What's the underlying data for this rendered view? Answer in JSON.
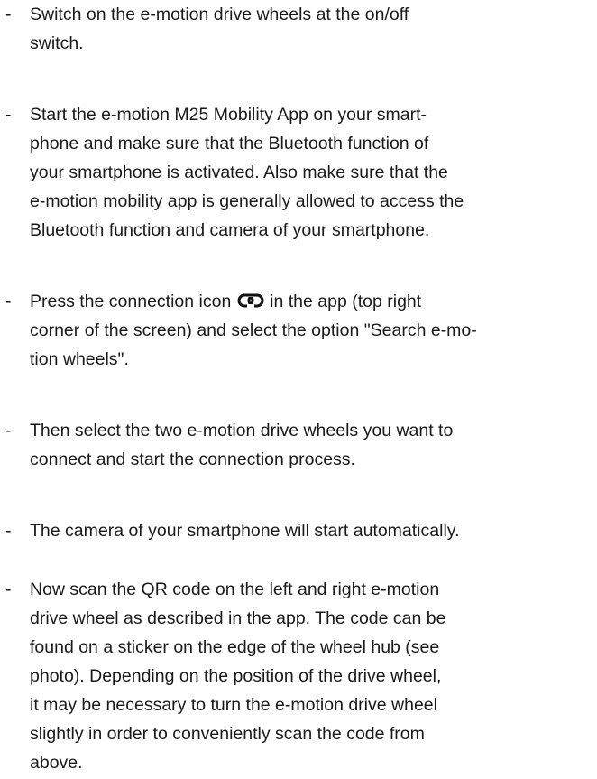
{
  "bullet": "-",
  "items": [
    {
      "lines": [
        "Switch on the e-motion drive wheels at the on/off",
        "switch."
      ]
    },
    {
      "lines": [
        "Start the e-motion M25 Mobility App on your smart-",
        "phone and make sure that the Bluetooth function of",
        "your smartphone is activated. Also make sure that the",
        "e-motion mobility app is generally allowed to access the",
        "Bluetooth function and camera of your smartphone."
      ]
    },
    {
      "line1_before_icon": "Press the connection icon",
      "icon": "link-icon",
      "line1_after_icon": "in the app (top right",
      "lines": [
        "corner of the screen) and select the option \"Search e-mo-",
        "tion wheels\"."
      ]
    },
    {
      "lines": [
        "Then select the two e-motion drive wheels you want to",
        "connect and start the connection process."
      ]
    },
    {
      "lines": [
        "The camera of your smartphone will start automatically."
      ]
    },
    {
      "lines": [
        "Now scan the QR code on the left and right e-motion",
        "drive wheel as described in the app. The code can be",
        "found on a sticker on the edge of the wheel hub (see",
        "photo). Depending on the position of the drive wheel,",
        "it may be necessary to turn the e-motion drive wheel",
        "slightly in order to conveniently scan the code from",
        "above."
      ]
    }
  ]
}
